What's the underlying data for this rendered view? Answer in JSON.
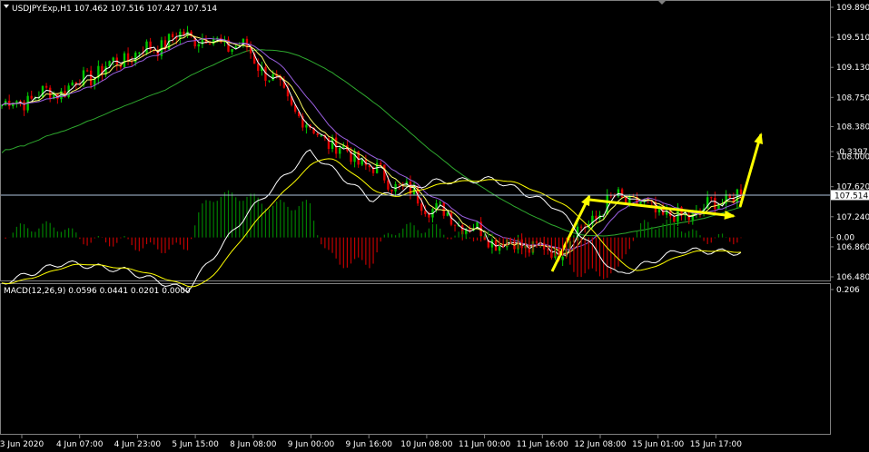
{
  "main_title": "USDJPY.Exp,H1  107.462 107.516 107.427 107.514",
  "price_axis": {
    "labels": [
      "109.890",
      "109.510",
      "109.130",
      "108.750",
      "108.380",
      "108.000",
      "107.620",
      "107.240",
      "106.860",
      "106.480"
    ],
    "min": 106.48,
    "max": 109.89,
    "current_price_label": "107.514",
    "current_price": 107.514
  },
  "macd": {
    "title": "MACD(12,26,9) 0.0596 0.0441 0.0201 0.0000",
    "axis_labels": [
      "0.206",
      "0.00",
      "-0.3397"
    ],
    "max": 0.206,
    "min": -0.3397
  },
  "time_axis": {
    "labels": [
      "3 Jun 2020",
      "4 Jun 07:00",
      "4 Jun 23:00",
      "5 Jun 15:00",
      "8 Jun 08:00",
      "9 Jun 00:00",
      "9 Jun 16:00",
      "10 Jun 08:00",
      "11 Jun 00:00",
      "11 Jun 16:00",
      "12 Jun 08:00",
      "15 Jun 01:00",
      "15 Jun 17:00"
    ]
  },
  "colors": {
    "background": "#000000",
    "bull_candle": "#00c800",
    "bear_candle": "#e00000",
    "fast_ma": "#ffffff",
    "ma_yellow": "#ffff66",
    "ma_purple": "#9a5fe0",
    "ma_slow": "#2ea82e",
    "signal_line": "#ffff00",
    "macd_line": "#ffffff",
    "hist_up": "#c00000",
    "hist_down": "#008000",
    "arrow": "#ffff00",
    "current_price_line": "#b0c4de"
  },
  "chart_data": {
    "type": "line",
    "x_labels": [
      "3 Jun 2020",
      "4 Jun 07:00",
      "4 Jun 23:00",
      "5 Jun 15:00",
      "8 Jun 08:00",
      "9 Jun 00:00",
      "9 Jun 16:00",
      "10 Jun 08:00",
      "11 Jun 00:00",
      "11 Jun 16:00",
      "12 Jun 08:00",
      "15 Jun 01:00",
      "15 Jun 17:00"
    ],
    "series": [
      {
        "values": [
          108.65,
          108.85,
          109.25,
          109.55,
          109.35,
          108.35,
          107.85,
          107.35,
          106.95,
          106.8,
          107.5,
          107.2,
          107.55
        ]
      },
      {
        "values": [
          0.18,
          0.1,
          0.13,
          0.21,
          -0.1,
          -0.34,
          -0.15,
          -0.22,
          -0.23,
          -0.12,
          0.15,
          0.05,
          0.06
        ]
      }
    ],
    "ylim": [
      106.48,
      109.89
    ]
  }
}
